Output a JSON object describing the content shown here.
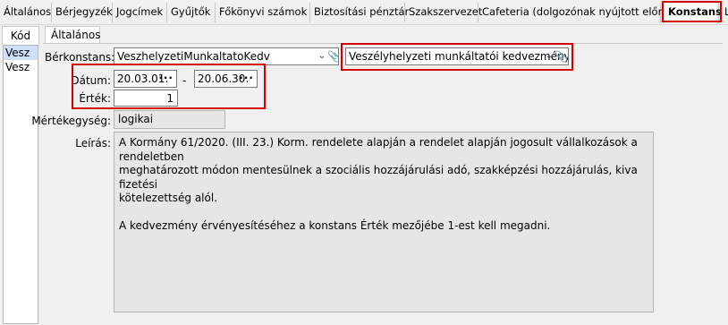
{
  "top_tabs": [
    "Általános",
    "Bérjegyzék",
    "Jogcímek",
    "Gyűjtők",
    "Főkönyvi számok",
    "Biztosítási pénztár",
    "Szakszervezet",
    "Cafeteria (dolgozónak nyújtott előny)",
    "Konstans",
    "L"
  ],
  "left_panel": {
    "tab_label": "Kód",
    "rows": [
      "Vesz",
      "Vesz"
    ]
  },
  "inner_tab": "Általános",
  "form": {
    "berkonstans_label": "Bérkonstans:",
    "berkonstans_value": "VeszhelyzetiMunkaltatoKedv",
    "berkonstans_desc": "Veszélyhelyzeti munkáltatói kedvezmény",
    "datum_label": "Dátum:",
    "date_from": "20.03.01.",
    "date_sep": "-",
    "date_to": "20.06.30.",
    "ertek_label": "Érték:",
    "ertek_value": "1",
    "mertekegyseg_label": "Mértékegység:",
    "mertekegyseg_value": "logikai",
    "leiras_label": "Leírás:",
    "leiras_value": "A Kormány 61/2020. (III. 23.) Korm. rendelete alapján a rendelet alapján jogosult vállalkozások a rendeletben\nmeghatározott módon mentesülnek a szociális hozzájárulási adó, szakképzési hozzájárulás, kiva fizetési\nkötelezettség alól.\n\nA kedvezmény érvényesítéséhez a konstans Érték mezőjébe 1-est kell megadni."
  },
  "icons": {
    "dropdown": "chevron-down-icon",
    "attach": "paperclip-icon",
    "date_picker": "ellipsis-icon"
  },
  "colors": {
    "highlight_border": "#d40000",
    "selection": "#cde0f7"
  }
}
